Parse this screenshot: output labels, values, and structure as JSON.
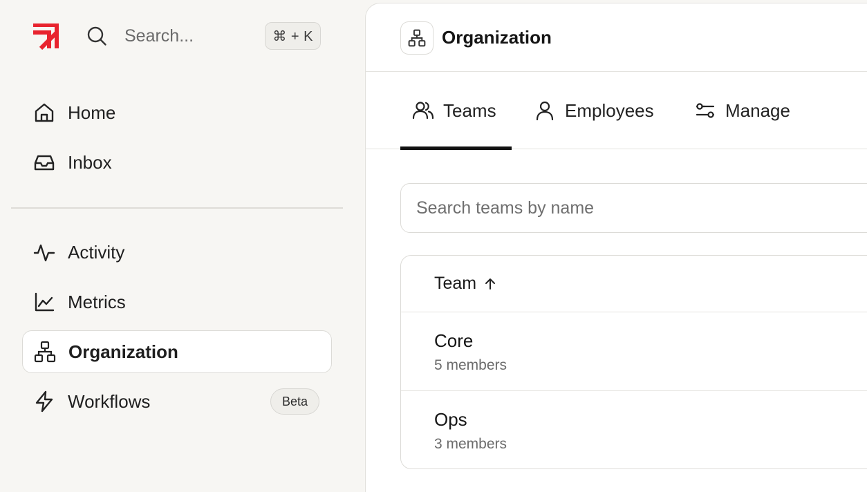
{
  "brand": {
    "accent": "#e8232e"
  },
  "search": {
    "placeholder": "Search...",
    "shortcut": "⌘ + K"
  },
  "sidebar": {
    "items": [
      {
        "label": "Home",
        "icon": "home-icon"
      },
      {
        "label": "Inbox",
        "icon": "inbox-icon"
      },
      {
        "label": "Activity",
        "icon": "activity-icon"
      },
      {
        "label": "Metrics",
        "icon": "chart-icon"
      },
      {
        "label": "Organization",
        "icon": "org-chart-icon",
        "active": true
      },
      {
        "label": "Workflows",
        "icon": "lightning-icon",
        "badge": "Beta"
      }
    ]
  },
  "header": {
    "title": "Organization",
    "icon": "org-chart-icon"
  },
  "tabs": [
    {
      "label": "Teams",
      "icon": "users-icon",
      "active": true
    },
    {
      "label": "Employees",
      "icon": "user-icon"
    },
    {
      "label": "Manage",
      "icon": "sliders-icon"
    }
  ],
  "teams": {
    "search_placeholder": "Search teams by name",
    "column_header": "Team",
    "sort": "ascending",
    "rows": [
      {
        "name": "Core",
        "members": "5 members"
      },
      {
        "name": "Ops",
        "members": "3 members"
      }
    ]
  }
}
